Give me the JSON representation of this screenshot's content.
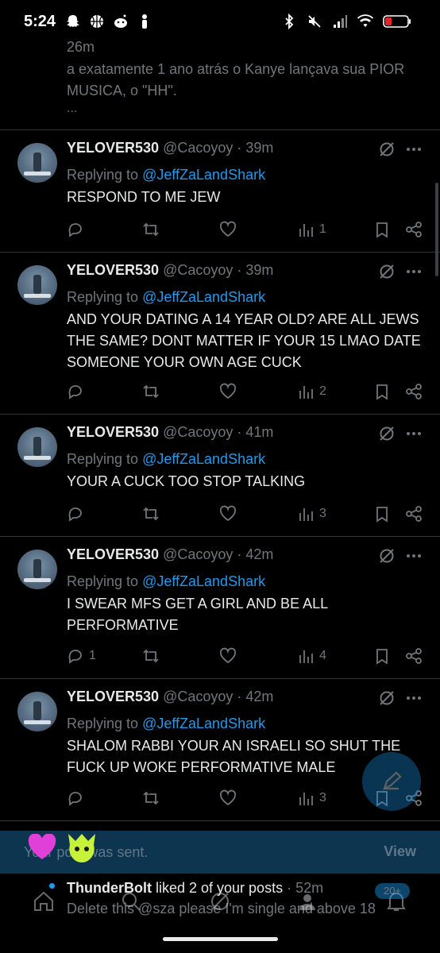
{
  "status_bar": {
    "time": "5:24"
  },
  "partial_post": {
    "time": "26m",
    "text": "a exatamente 1 ano atrás o Kanye lançava sua PIOR MUSICA, o \"HH\".",
    "more": "..."
  },
  "tweets": [
    {
      "name": "YELOVER530",
      "handle_time": "@Cacoyoy · 39m",
      "replying_prefix": "Replying to ",
      "replying_to": "@JeffZaLandShark",
      "text": "RESPOND TO ME JEW",
      "replies": "",
      "views": "1"
    },
    {
      "name": "YELOVER530",
      "handle_time": "@Cacoyoy · 39m",
      "replying_prefix": "Replying to ",
      "replying_to": "@JeffZaLandShark",
      "text": "AND YOUR DATING A 14 YEAR OLD? ARE ALL JEWS THE SAME? DONT MATTER IF YOUR 15 LMAO DATE SOMEONE YOUR OWN AGE CUCK",
      "replies": "",
      "views": "2"
    },
    {
      "name": "YELOVER530",
      "handle_time": "@Cacoyoy · 41m",
      "replying_prefix": "Replying to ",
      "replying_to": "@JeffZaLandShark",
      "text": "YOUR A CUCK TOO STOP TALKING",
      "replies": "",
      "views": "3"
    },
    {
      "name": "YELOVER530",
      "handle_time": "@Cacoyoy · 42m",
      "replying_prefix": "Replying to ",
      "replying_to": "@JeffZaLandShark",
      "text": "I SWEAR MFS GET A GIRL AND BE ALL PERFORMATIVE",
      "replies": "1",
      "views": "4"
    },
    {
      "name": "YELOVER530",
      "handle_time": "@Cacoyoy · 42m",
      "replying_prefix": "Replying to ",
      "replying_to": "@JeffZaLandShark",
      "text": "SHALOM RABBI YOUR AN ISRAELI SO SHUT THE FUCK UP WOKE PERFORMATIVE MALE",
      "replies": "",
      "views": "3"
    }
  ],
  "toast": {
    "message": "Your post was sent.",
    "action": "View"
  },
  "notification": {
    "name": "ThunderBolt",
    "action": " liked 2 of your posts",
    "time": " · 52m",
    "preview": "Delete this @sza please I'm single and above 18"
  },
  "nav": {
    "badge": "20+"
  },
  "colors": {
    "accent": "#1d9bf0",
    "muted": "#71767b",
    "background": "#000000",
    "divider": "#2f3336"
  }
}
